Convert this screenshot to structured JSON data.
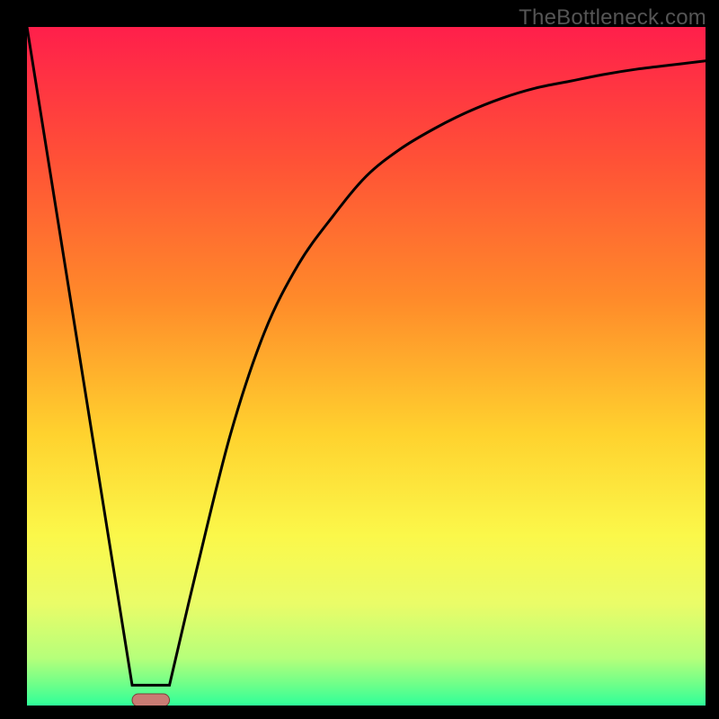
{
  "watermark": "TheBottleneck.com",
  "chart_data": {
    "type": "line",
    "title": "",
    "xlabel": "",
    "ylabel": "",
    "xlim": [
      0,
      100
    ],
    "ylim": [
      0,
      100
    ],
    "plateau_y": 3,
    "plateau_x_range": [
      15.5,
      21
    ],
    "curve_points": [
      {
        "x": 0,
        "y": 100
      },
      {
        "x": 15.5,
        "y": 3
      },
      {
        "x": 21,
        "y": 3
      },
      {
        "x": 25,
        "y": 20
      },
      {
        "x": 30,
        "y": 40
      },
      {
        "x": 35,
        "y": 55
      },
      {
        "x": 40,
        "y": 65
      },
      {
        "x": 45,
        "y": 72
      },
      {
        "x": 50,
        "y": 78
      },
      {
        "x": 55,
        "y": 82
      },
      {
        "x": 60,
        "y": 85
      },
      {
        "x": 65,
        "y": 87.5
      },
      {
        "x": 70,
        "y": 89.5
      },
      {
        "x": 75,
        "y": 91
      },
      {
        "x": 80,
        "y": 92
      },
      {
        "x": 85,
        "y": 93
      },
      {
        "x": 90,
        "y": 93.8
      },
      {
        "x": 95,
        "y": 94.4
      },
      {
        "x": 100,
        "y": 95
      }
    ],
    "gradient_stops": [
      {
        "offset": 0.0,
        "color": "#ff1f4b"
      },
      {
        "offset": 0.2,
        "color": "#ff5236"
      },
      {
        "offset": 0.4,
        "color": "#ff8a2a"
      },
      {
        "offset": 0.6,
        "color": "#ffd22e"
      },
      {
        "offset": 0.75,
        "color": "#fbf84a"
      },
      {
        "offset": 0.85,
        "color": "#eafc68"
      },
      {
        "offset": 0.93,
        "color": "#b6ff7a"
      },
      {
        "offset": 0.97,
        "color": "#6cff8a"
      },
      {
        "offset": 1.0,
        "color": "#2fff99"
      }
    ],
    "marker": {
      "x_range": [
        15.5,
        21
      ],
      "y": 0,
      "color": "#c97b74",
      "stroke": "#7d3f39"
    }
  }
}
